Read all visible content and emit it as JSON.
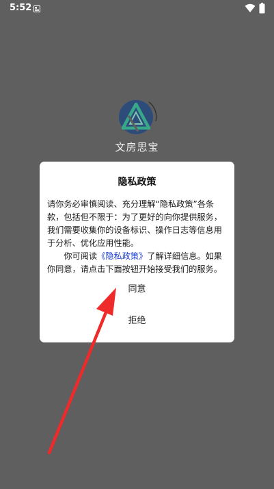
{
  "status_bar": {
    "time": "5:52",
    "notification_icon": "notification-icon",
    "wifi_icon": "wifi-icon",
    "battery_icon": "battery-icon"
  },
  "splash": {
    "logo_icon": "app-logo-icon",
    "app_name": "文房思宝"
  },
  "dialog": {
    "title": "隐私政策",
    "paragraph1": "请你务必审慎阅读、充分理解“隐私政策”各条款，包括但不限于：为了更好的向你提供服务，我们需要收集你的设备标识、操作日志等信息用于分析、优化应用性能。",
    "paragraph2_prefix": "你可阅读",
    "privacy_link": "《隐私政策》",
    "paragraph2_suffix": "了解详细信息。如果你同意，请点击下面按钮开始接受我们的服务。",
    "agree_label": "同意",
    "reject_label": "拒绝"
  },
  "colors": {
    "overlay_background": "#5f5f5f",
    "dialog_background": "#ffffff",
    "link": "#1d3fd6",
    "annotation_arrow": "#ee2a2a"
  }
}
